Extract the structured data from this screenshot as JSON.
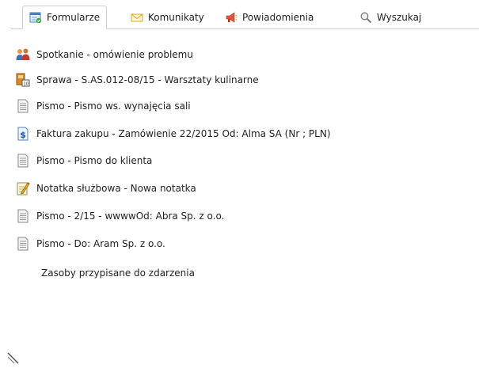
{
  "tabs": [
    {
      "label": "Formularze",
      "icon": "form-icon",
      "active": true
    },
    {
      "label": "Komunikaty",
      "icon": "envelope-icon",
      "active": false
    },
    {
      "label": "Powiadomienia",
      "icon": "megaphone-icon",
      "active": false
    },
    {
      "label": "Wyszukaj",
      "icon": "magnifier-icon",
      "active": false
    }
  ],
  "items": [
    {
      "label": "Spotkanie - omówienie problemu",
      "icon": "meeting-people-icon"
    },
    {
      "label": "Sprawa - S.AS.012-08/15 - Warsztaty kulinarne",
      "icon": "case-binder-icon"
    },
    {
      "label": "Pismo - Pismo ws. wynajęcia sali",
      "icon": "document-icon"
    },
    {
      "label": "Faktura zakupu - Zamówienie 22/2015 Od: Alma SA (Nr ; PLN)",
      "icon": "invoice-dollar-icon"
    },
    {
      "label": "Pismo - Pismo do klienta",
      "icon": "document-icon"
    },
    {
      "label": "Notatka służbowa - Nowa notatka",
      "icon": "note-pencil-icon"
    },
    {
      "label": "Pismo - 2/15 - wwwwOd: Abra Sp. z o.o.",
      "icon": "document-icon"
    },
    {
      "label": "Pismo - Do: Aram Sp. z o.o.",
      "icon": "document-icon"
    }
  ],
  "resources_label": "Zasoby przypisane do zdarzenia",
  "colors": {
    "tab_border": "#cfcfcf",
    "text": "#222222"
  }
}
